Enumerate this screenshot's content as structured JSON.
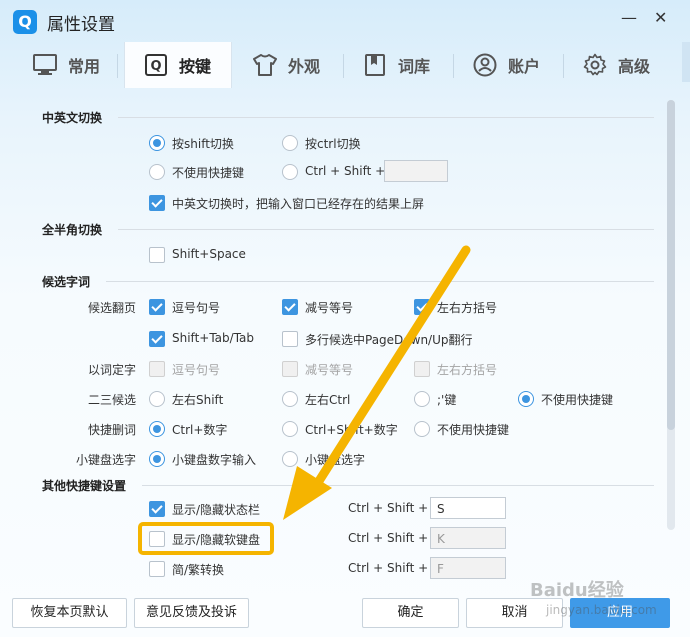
{
  "window": {
    "title": "属性设置",
    "logo": "Q",
    "minimize": "—",
    "close": "✕"
  },
  "tabs": [
    {
      "label": "常用",
      "icon": "monitor-icon"
    },
    {
      "label": "按键",
      "icon": "key-q-icon"
    },
    {
      "label": "外观",
      "icon": "tshirt-icon"
    },
    {
      "label": "词库",
      "icon": "book-icon"
    },
    {
      "label": "账户",
      "icon": "user-icon"
    },
    {
      "label": "高级",
      "icon": "gear-icon"
    }
  ],
  "cn_en": {
    "title": "中英文切换",
    "opt_shift": "按shift切换",
    "opt_ctrl": "按ctrl切换",
    "opt_none": "不使用快捷键",
    "opt_combo": "Ctrl + Shift +",
    "combo_value": "",
    "commit_label": "中英文切换时，把输入窗口已经存在的结果上屏"
  },
  "half_full": {
    "title": "全半角切换",
    "shift_space": "Shift+Space"
  },
  "candidates": {
    "title": "候选字词",
    "page_label": "候选翻页",
    "comma_period": "逗号句号",
    "minus_equal": "减号等号",
    "brackets": "左右方括号",
    "shift_tab": "Shift+Tab/Tab",
    "pagedown": "多行候选中PageDown/Up翻行",
    "word_label": "以词定字",
    "word_comma": "逗号句号",
    "word_minus": "减号等号",
    "word_brackets": "左右方括号",
    "two_three_label": "二三候选",
    "left_right_shift": "左右Shift",
    "left_right_ctrl": "左右Ctrl",
    "semicolon_key": ";'键",
    "no_shortcut": "不使用快捷键",
    "delete_label": "快捷删词",
    "ctrl_num": "Ctrl+数字",
    "ctrl_shift_num": "Ctrl+Shift+数字",
    "delete_none": "不使用快捷键",
    "keypad_label": "小键盘选字",
    "keypad_num": "小键盘数字输入",
    "keypad_select": "小键盘选字"
  },
  "other": {
    "title": "其他快捷键设置",
    "items": [
      {
        "label": "显示/隐藏状态栏",
        "combo": "Ctrl + Shift +",
        "key": "S"
      },
      {
        "label": "显示/隐藏软键盘",
        "combo": "Ctrl + Shift +",
        "key": "K"
      },
      {
        "label": "简/繁转换",
        "combo": "Ctrl + Shift +",
        "key": "F"
      }
    ]
  },
  "footer": {
    "restore": "恢复本页默认",
    "feedback": "意见反馈及投诉",
    "ok": "确定",
    "cancel": "取消",
    "apply": "应用"
  },
  "watermark": {
    "brand": "Baidu经验",
    "url": "jingyan.baidu.com"
  },
  "colors": {
    "accent": "#3d95e0",
    "highlight": "#f5b400",
    "arrow": "#f5b400"
  }
}
